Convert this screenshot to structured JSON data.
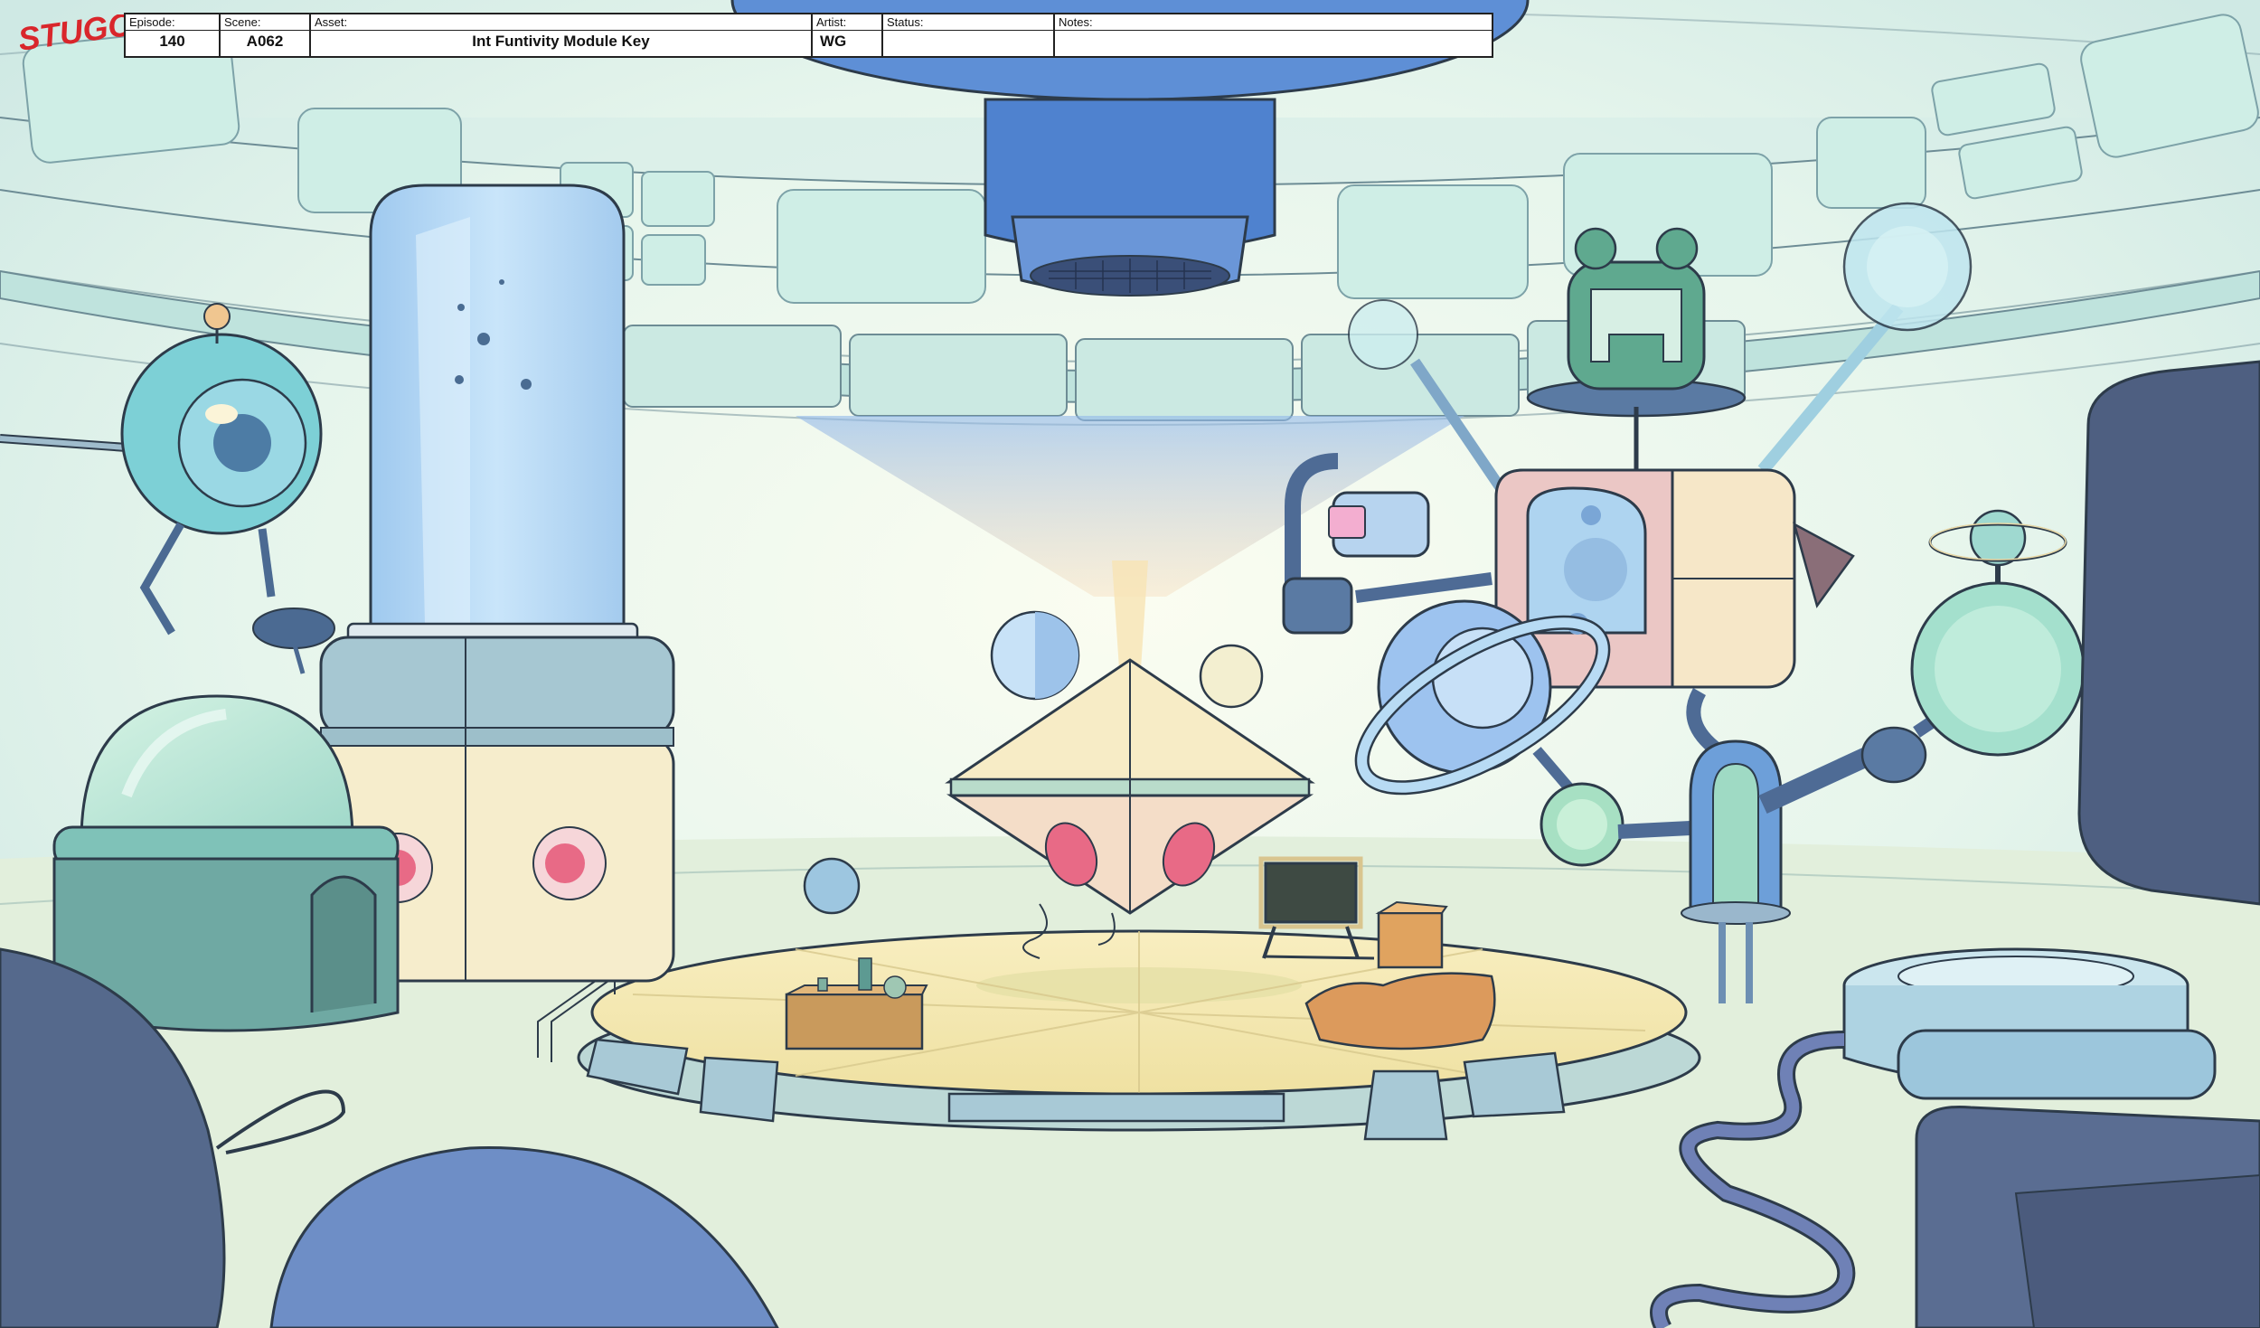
{
  "logo": {
    "text": "STUGO",
    "color": "#d9262b"
  },
  "slate": {
    "episode": {
      "label": "Episode:",
      "value": "140"
    },
    "scene": {
      "label": "Scene:",
      "value": "A062"
    },
    "asset": {
      "label": "Asset:",
      "value": "Int Funtivity Module Key"
    },
    "artist": {
      "label": "Artist:",
      "value": "WG"
    },
    "status": {
      "label": "Status:",
      "value": ""
    },
    "notes": {
      "label": "Notes:",
      "value": ""
    }
  },
  "palette": {
    "sky": "#e4f3ee",
    "wall": "#d8eee6",
    "floor": "#e3f1da",
    "platform": "#f4eab0",
    "blue_dark": "#4f6a95",
    "blue_mid": "#6f9fd8",
    "glass": "#b8e2f2",
    "teal": "#7fc7b8",
    "cream": "#f6edcc",
    "pink": "#e57a92",
    "line": "#2d3b4a"
  }
}
